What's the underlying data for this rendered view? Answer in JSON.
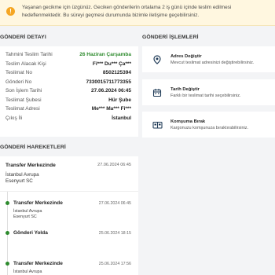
{
  "alert": {
    "text": "Yaşanan gecikme için üzgünüz. Geciken gönderilerin ortalama 2 iş günü içinde teslim edilmesi hedeflenmektedir. Bu süreyi geçmesi durumunda bizimle iletişime geçebilirsiniz."
  },
  "detail": {
    "title": "GÖNDERİ DETAYI",
    "rows": [
      {
        "label": "Tahmini Teslim Tarihi",
        "value": "26 Haziran Çarşamba"
      },
      {
        "label": "Teslim Alacak Kişi",
        "value": "Fi*** Du*** Ça***"
      },
      {
        "label": "Teslimat No",
        "value": "8502125394"
      },
      {
        "label": "Gönderi No",
        "value": "7330015711773355"
      },
      {
        "label": "Son İşlem Tarihi",
        "value": "27.06.2024 06:45"
      },
      {
        "label": "Teslimat Şubesi",
        "value": "Hür Şube"
      },
      {
        "label": "Teslimat Adresi",
        "value": "Me*** Ma*** Fi***"
      },
      {
        "label": "Çıkış İli",
        "value": "İstanbul"
      }
    ]
  },
  "operations": {
    "title": "GÖNDERİ İŞLEMLERİ",
    "items": [
      {
        "title": "Adres Değiştir",
        "desc": "Mevcut teslimat adresinizi değiştirebilirsiniz.",
        "icon": "location-pin-icon"
      },
      {
        "title": "Tarih Değiştir",
        "desc": "Farklı bir teslimat tarihi seçebilirsiniz.",
        "icon": "calendar-icon"
      },
      {
        "title": "Komşuma Bırak",
        "desc": "Kargonuzu komşunuza bıraktırabilirsiniz.",
        "icon": "neighbor-house-icon"
      }
    ]
  },
  "history": {
    "title": "GÖNDERİ HAREKETLERİ",
    "first": {
      "title": "Transfer Merkezinde",
      "date": "27.06.2024 06:45",
      "line1": "İstanbul Avrupa",
      "line2": "Esenyurt SC"
    },
    "items": [
      {
        "title": "Transfer Merkezinde",
        "date": "27.06.2024 06:45",
        "line1": "İstanbul Avrupa",
        "line2": "Esenyurt SC"
      },
      {
        "title": "Gönderi Yolda",
        "date": "25.06.2024 18:15"
      },
      {
        "title": "Transfer Merkezinde",
        "date": "25.06.2024 17:56",
        "line1": "İstanbul Avrupa"
      }
    ]
  },
  "colors": {
    "accent_green": "#2e8b2e",
    "alert_bg": "#fff7e0",
    "alert_icon": "#f5a623",
    "icon_blue": "#1f3b57"
  }
}
